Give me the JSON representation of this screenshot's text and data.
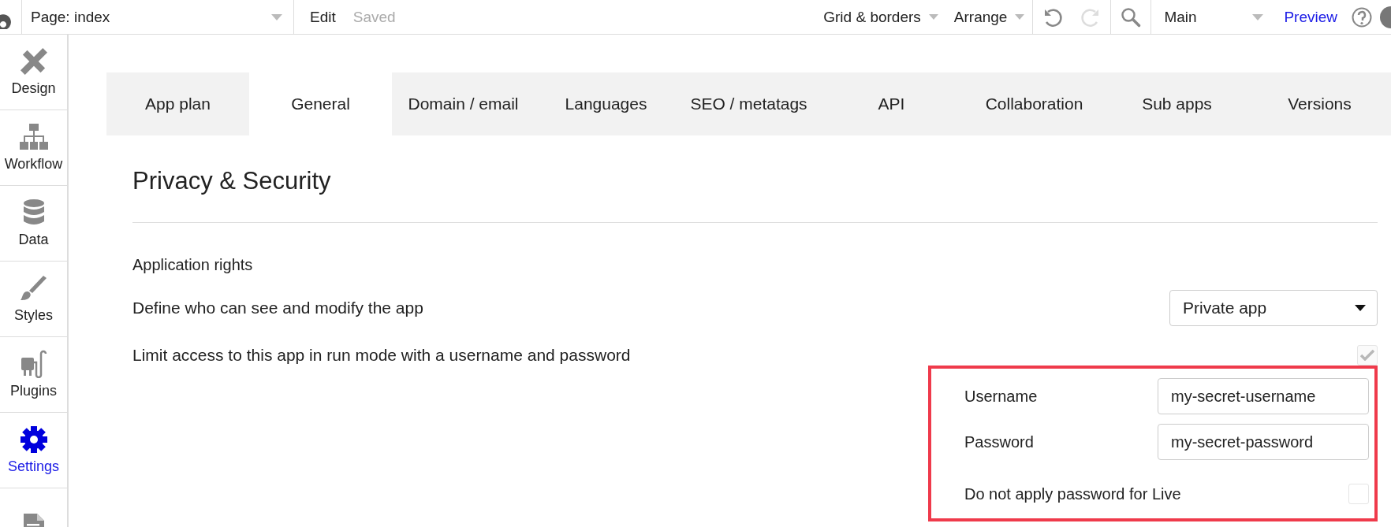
{
  "topbar": {
    "page_select": "Page: index",
    "edit": "Edit",
    "save_status": "Saved",
    "grid_menu": "Grid & borders",
    "arrange_menu": "Arrange",
    "view_select": "Main",
    "preview": "Preview"
  },
  "sidebar": {
    "items": [
      {
        "kind": "design",
        "label": "Design",
        "selected": false
      },
      {
        "kind": "workflow",
        "label": "Workflow",
        "selected": false
      },
      {
        "kind": "data",
        "label": "Data",
        "selected": false
      },
      {
        "kind": "styles",
        "label": "Styles",
        "selected": false
      },
      {
        "kind": "plugins",
        "label": "Plugins",
        "selected": false
      },
      {
        "kind": "settings",
        "label": "Settings",
        "selected": true
      },
      {
        "kind": "logs",
        "selected": false
      }
    ]
  },
  "tabs": [
    {
      "label": "App plan",
      "selected": false
    },
    {
      "label": "General",
      "selected": true
    },
    {
      "label": "Domain / email",
      "selected": false
    },
    {
      "label": "Languages",
      "selected": false
    },
    {
      "label": "SEO / metatags",
      "selected": false
    },
    {
      "label": "API",
      "selected": false
    },
    {
      "label": "Collaboration",
      "selected": false
    },
    {
      "label": "Sub apps",
      "selected": false
    },
    {
      "label": "Versions",
      "selected": false
    }
  ],
  "section": {
    "title": "Privacy & Security",
    "subtitle": "Application rights",
    "rights": {
      "label": "Define who can see and modify the app",
      "value": "Private app"
    },
    "limit_access": {
      "label": "Limit access to this app in run mode with a username and password",
      "checked": true,
      "disabled": true
    },
    "credentials": {
      "username_label": "Username",
      "username": "my-secret-username",
      "password_label": "Password",
      "password": "my-secret-password",
      "live_exempt": {
        "label": "Do not apply password for Live",
        "checked": false
      }
    }
  }
}
